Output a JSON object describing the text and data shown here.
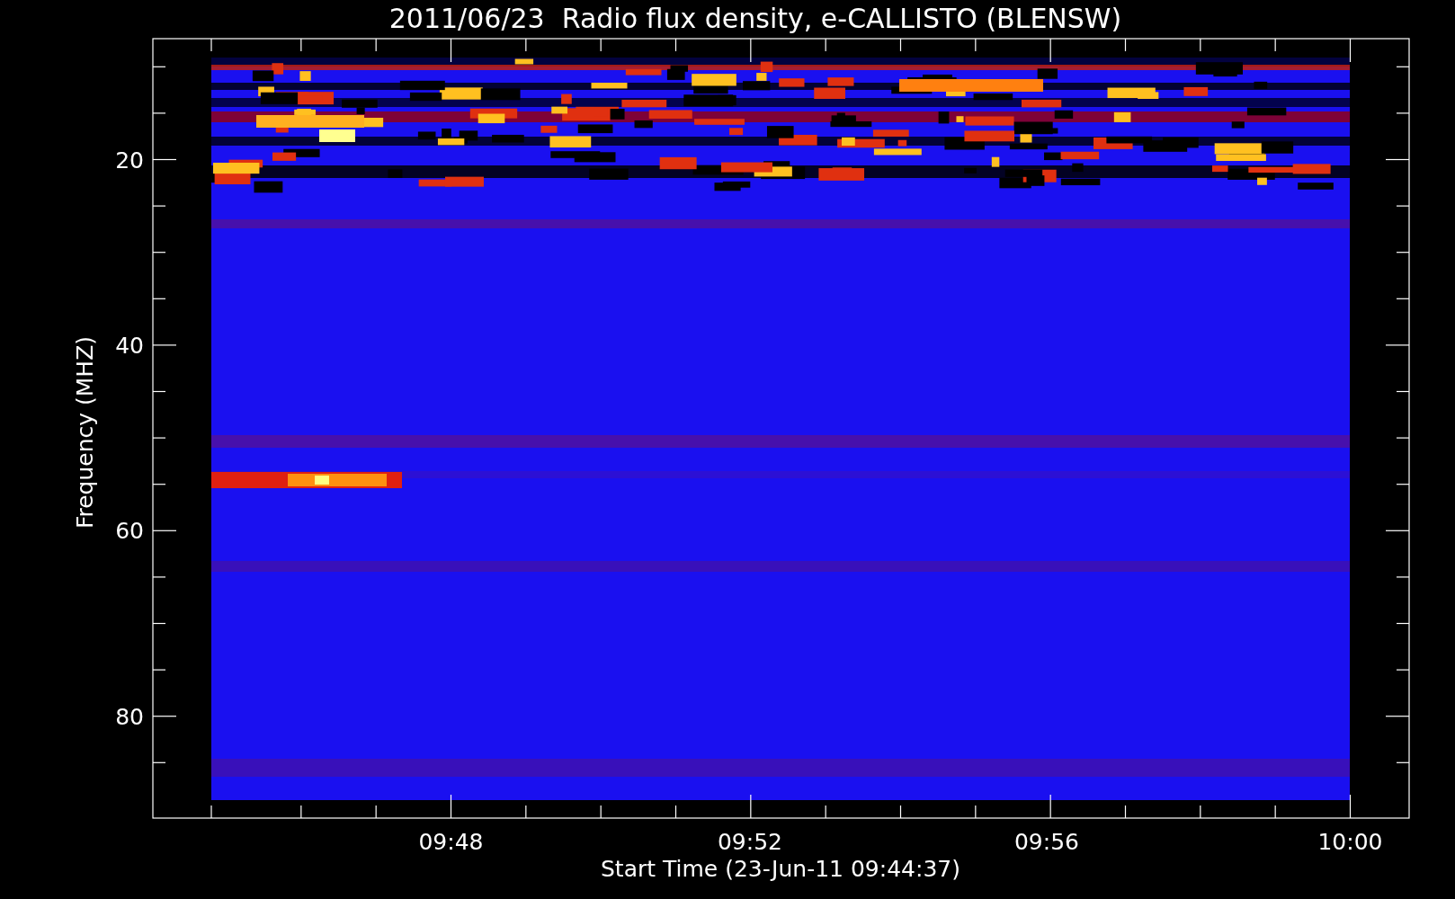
{
  "title": "2011/06/23  Radio flux density, e-CALLISTO (BLENSW)",
  "xlabel": "Start Time (23-Jun-11 09:44:37)",
  "ylabel": "Frequency (MHZ)",
  "xticks": [
    "09:48",
    "09:52",
    "09:56",
    "10:00"
  ],
  "yticks": [
    "20",
    "40",
    "60",
    "80"
  ]
}
